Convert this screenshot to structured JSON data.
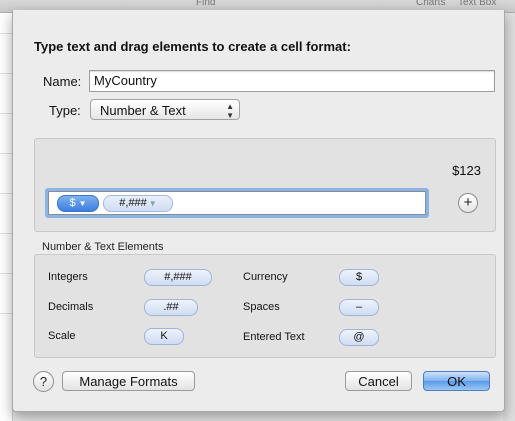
{
  "background": {
    "toolbar": {
      "find": "Find",
      "charts": "Charts",
      "text_box": "Text Box"
    }
  },
  "dialog": {
    "heading": "Type text and drag elements to create a cell format:",
    "name_label": "Name:",
    "name_value": "MyCountry",
    "type_label": "Type:",
    "type_value": "Number & Text",
    "preview": "$123",
    "format_tokens": [
      {
        "text": "$",
        "selected": true
      },
      {
        "text": "#,###",
        "selected": false
      }
    ],
    "elements_title": "Number & Text Elements",
    "elements": [
      {
        "label": "Integers",
        "token": "#,###"
      },
      {
        "label": "Decimals",
        "token": ".##"
      },
      {
        "label": "Scale",
        "token": "K"
      },
      {
        "label": "Currency",
        "token": "$"
      },
      {
        "label": "Spaces",
        "token": "–"
      },
      {
        "label": "Entered Text",
        "token": "@"
      }
    ],
    "buttons": {
      "help": "?",
      "manage": "Manage Formats",
      "cancel": "Cancel",
      "ok": "OK",
      "add": "+"
    }
  },
  "colors": {
    "accent_token": "#3c7ee0",
    "focus_ring": "#8ab3e6",
    "default_button": "#5c9ae8"
  }
}
